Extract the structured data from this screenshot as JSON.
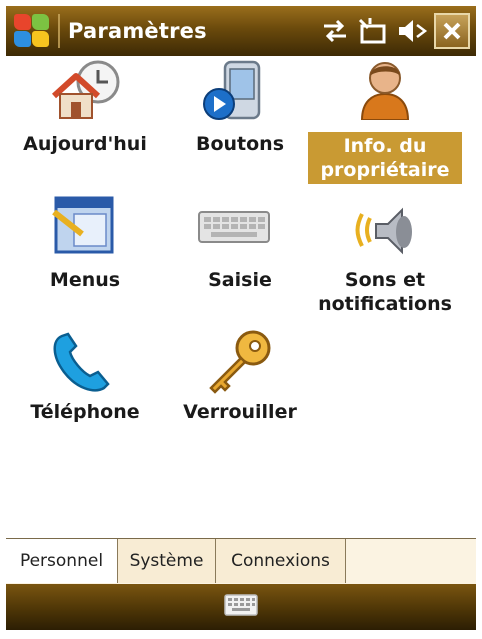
{
  "titlebar": {
    "title": "Paramètres",
    "icons": [
      "windows-start-icon",
      "connectivity-icon",
      "signal-icon",
      "volume-icon",
      "close-icon"
    ],
    "close_label": "✕"
  },
  "tiles": [
    {
      "label": "Aujourd'hui",
      "icon": "today-icon"
    },
    {
      "label": "Boutons",
      "icon": "buttons-icon"
    },
    {
      "label_lines": [
        "Info. du",
        "propriétaire"
      ],
      "icon": "owner-icon",
      "selected": true
    },
    {
      "label": "Menus",
      "icon": "menus-icon"
    },
    {
      "label": "Saisie",
      "icon": "keyboard-input-icon"
    },
    {
      "label_lines": [
        "Sons et",
        "notifications"
      ],
      "icon": "sounds-icon"
    },
    {
      "label": "Téléphone",
      "icon": "phone-icon"
    },
    {
      "label": "Verrouiller",
      "icon": "lock-key-icon"
    }
  ],
  "tabs": [
    {
      "label": "Personnel",
      "active": true
    },
    {
      "label": "Système",
      "active": false
    },
    {
      "label": "Connexions",
      "active": false
    }
  ],
  "bottombar": {
    "icon": "keyboard-icon"
  },
  "colors": {
    "titlebar": "#6b4a0c",
    "selection": "#c99a33",
    "tabs_bg": "#f8ecd4"
  }
}
